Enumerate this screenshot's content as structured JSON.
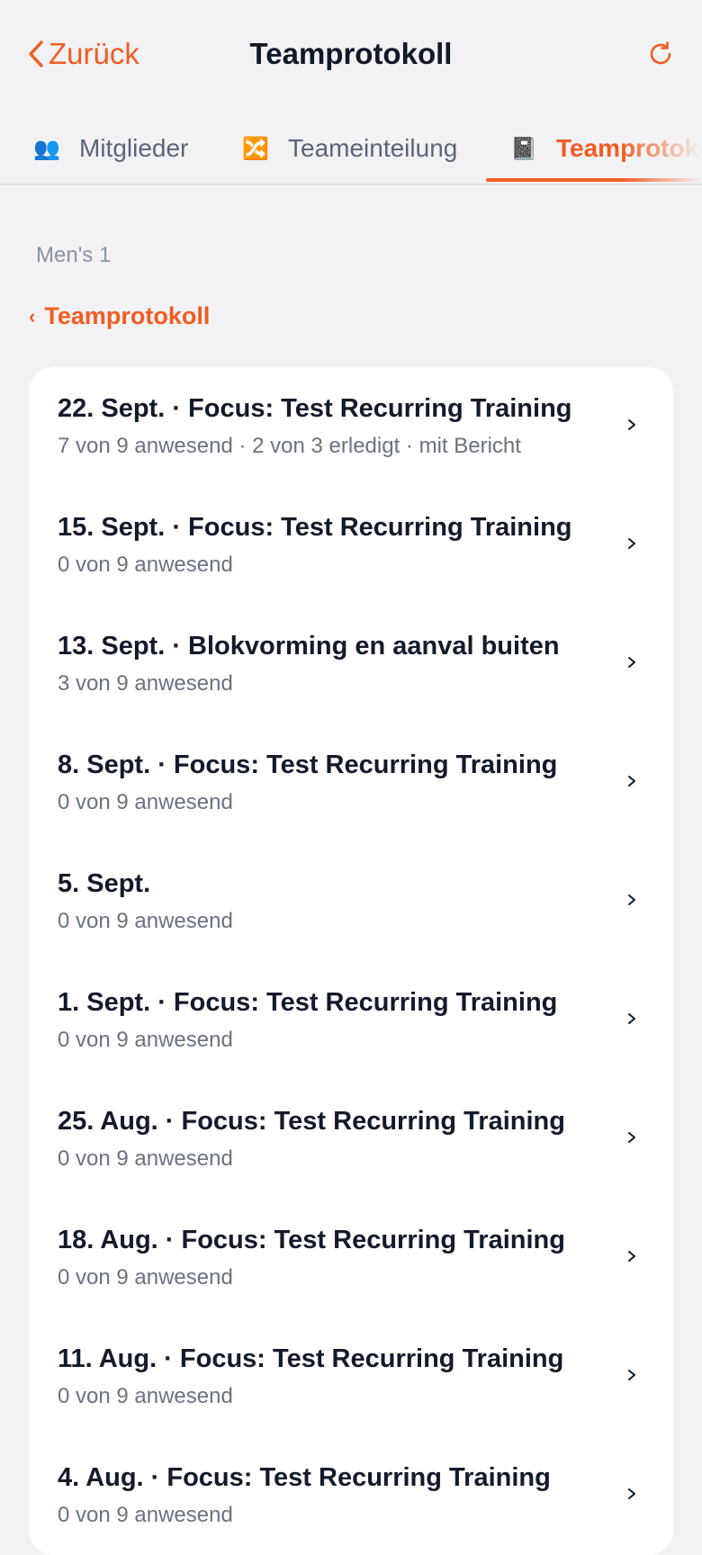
{
  "header": {
    "back_label": "Zurück",
    "title": "Teamprotokoll",
    "refresh_icon": "refresh-icon",
    "accent_color": "#f25c22"
  },
  "tabs": [
    {
      "icon": "👥",
      "label": "Mitglieder"
    },
    {
      "icon": "🔀",
      "label": "Teameinteilung"
    },
    {
      "icon": "📓",
      "label": "Teamprotokoll",
      "active": true
    }
  ],
  "team": {
    "name": "Men's 1",
    "section_link": "Teamprotokoll"
  },
  "entries": [
    {
      "title": "22. Sept. · Focus: Test Recurring Training",
      "subtitle": "7 von 9 anwesend · 2 von 3 erledigt · mit Bericht"
    },
    {
      "title": "15. Sept. · Focus: Test Recurring Training",
      "subtitle": "0 von 9 anwesend"
    },
    {
      "title": "13. Sept. · Blokvorming en aanval buiten",
      "subtitle": "3 von 9 anwesend"
    },
    {
      "title": "8. Sept. · Focus: Test Recurring Training",
      "subtitle": "0 von 9 anwesend"
    },
    {
      "title": "5. Sept.",
      "subtitle": "0 von 9 anwesend"
    },
    {
      "title": "1. Sept. · Focus: Test Recurring Training",
      "subtitle": "0 von 9 anwesend"
    },
    {
      "title": "25. Aug. · Focus: Test Recurring Training",
      "subtitle": "0 von 9 anwesend"
    },
    {
      "title": "18. Aug. · Focus: Test Recurring Training",
      "subtitle": "0 von 9 anwesend"
    },
    {
      "title": "11. Aug. · Focus: Test Recurring Training",
      "subtitle": "0 von 9 anwesend"
    },
    {
      "title": "4. Aug. · Focus: Test Recurring Training",
      "subtitle": "0 von 9 anwesend"
    }
  ]
}
